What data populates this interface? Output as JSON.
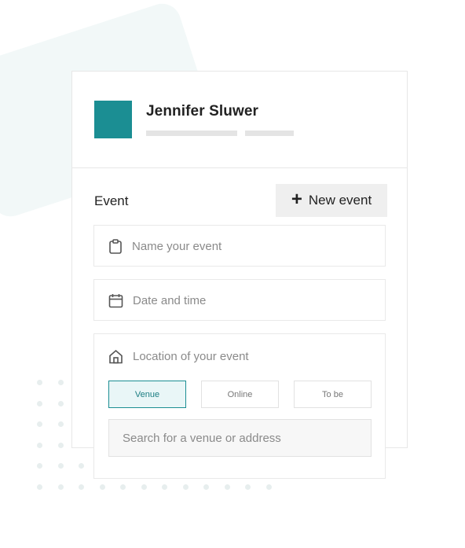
{
  "profile": {
    "name": "Jennifer Sluwer"
  },
  "event_section": {
    "label": "Event",
    "new_event_button": "New event",
    "plus_glyph": "+"
  },
  "fields": {
    "name_placeholder": "Name your event",
    "date_placeholder": "Date and time",
    "location_label": "Location of your event",
    "location_options": [
      "Venue",
      "Online",
      "To be"
    ],
    "selected_location_option": "Venue",
    "search_placeholder": "Search for a venue or address"
  },
  "icons": {
    "name": "clipboard-icon",
    "date": "calendar-icon",
    "location": "home-icon"
  },
  "colors": {
    "accent": "#1b8e93",
    "accent_bg": "#e9f6f7",
    "muted_text": "#8a8a8a",
    "border": "#e7e7e7"
  }
}
